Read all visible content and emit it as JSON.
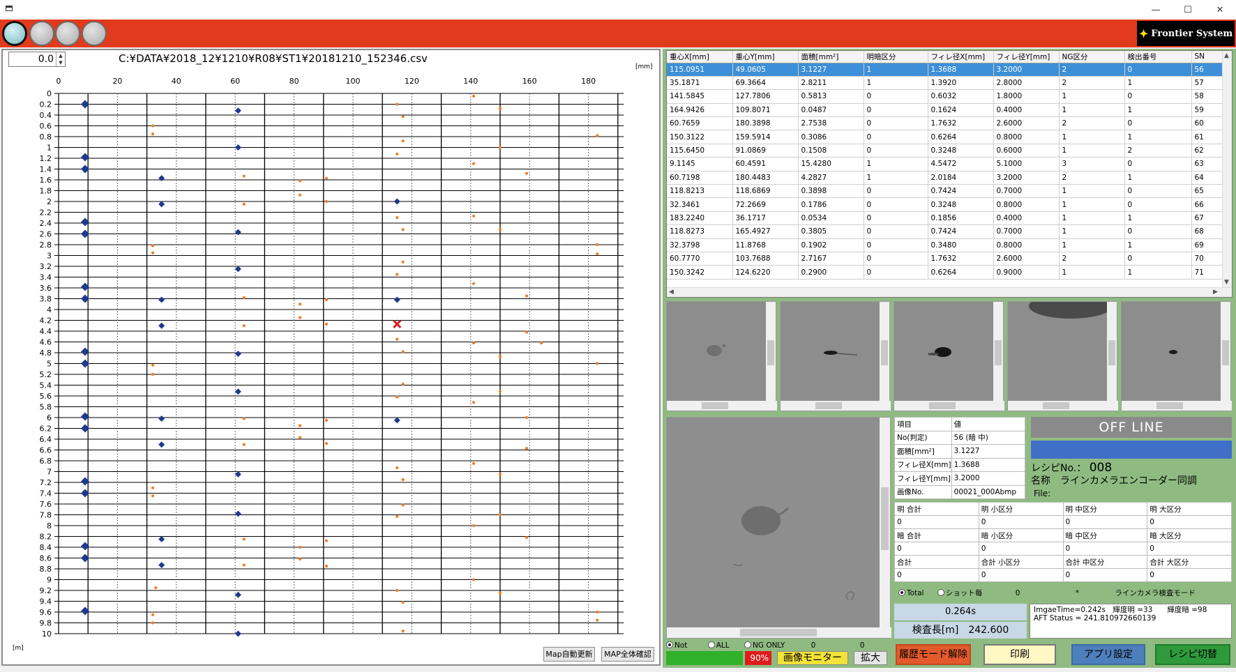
{
  "window": {
    "minimize": "—",
    "maximize": "☐",
    "close": "✕"
  },
  "logo": {
    "text": "Frontier System"
  },
  "map": {
    "spin_value": "0.0",
    "file_path": "C:¥DATA¥2018_12¥1210¥R08¥ST1¥20181210_152346.csv",
    "x_unit": "[mm]",
    "y_unit": "[m]",
    "x_ticks": [
      "0",
      "20",
      "40",
      "60",
      "80",
      "100",
      "120",
      "140",
      "160",
      "180"
    ],
    "y_ticks": [
      "0",
      "0.2",
      "0.4",
      "0.6",
      "0.8",
      "1",
      "1.2",
      "1.4",
      "1.6",
      "1.8",
      "2",
      "2.2",
      "2.4",
      "2.6",
      "2.8",
      "3",
      "3.2",
      "3.4",
      "3.6",
      "3.8",
      "4",
      "4.2",
      "4.4",
      "4.6",
      "4.8",
      "5",
      "5.2",
      "5.4",
      "5.6",
      "5.8",
      "6",
      "6.2",
      "6.4",
      "6.6",
      "6.8",
      "7",
      "7.2",
      "7.4",
      "7.6",
      "7.8",
      "8",
      "8.2",
      "8.4",
      "8.6",
      "8.8",
      "9",
      "9.2",
      "9.4",
      "9.6",
      "9.8",
      "10"
    ],
    "auto_update_btn": "Map自動更新",
    "full_view_btn": "MAP全体確認",
    "colors": {
      "large": "#1e3a8c",
      "small": "#f07d22",
      "selected": "#d62020"
    }
  },
  "grid": {
    "columns": [
      "重心X[mm]",
      "重心Y[mm]",
      "面積[mm²]",
      "明暗区分",
      "フィレ径X[mm]",
      "フィレ径Y[mm]",
      "NG区分",
      "検出番号",
      "SN"
    ],
    "rows": [
      [
        "115.0951",
        "49.0605",
        "3.1227",
        "1",
        "1.3688",
        "3.2000",
        "2",
        "0",
        "56"
      ],
      [
        "35.1871",
        "69.3664",
        "2.8211",
        "1",
        "1.3920",
        "2.8000",
        "2",
        "1",
        "57"
      ],
      [
        "141.5845",
        "127.7806",
        "0.5813",
        "0",
        "0.6032",
        "1.8000",
        "1",
        "0",
        "58"
      ],
      [
        "164.9426",
        "109.8071",
        "0.0487",
        "0",
        "0.1624",
        "0.4000",
        "1",
        "1",
        "59"
      ],
      [
        "60.7659",
        "180.3898",
        "2.7538",
        "0",
        "1.7632",
        "2.6000",
        "2",
        "0",
        "60"
      ],
      [
        "150.3122",
        "159.5914",
        "0.3086",
        "0",
        "0.6264",
        "0.8000",
        "1",
        "1",
        "61"
      ],
      [
        "115.6450",
        "91.0869",
        "0.1508",
        "0",
        "0.3248",
        "0.6000",
        "1",
        "2",
        "62"
      ],
      [
        "9.1145",
        "60.4591",
        "15.4280",
        "1",
        "4.5472",
        "5.1000",
        "3",
        "0",
        "63"
      ],
      [
        "60.7198",
        "180.4483",
        "4.2827",
        "1",
        "2.0184",
        "3.2000",
        "2",
        "1",
        "64"
      ],
      [
        "118.8213",
        "118.6869",
        "0.3898",
        "0",
        "0.7424",
        "0.7000",
        "1",
        "0",
        "65"
      ],
      [
        "32.3461",
        "72.2669",
        "0.1786",
        "0",
        "0.3248",
        "0.8000",
        "1",
        "0",
        "66"
      ],
      [
        "183.2240",
        "36.1717",
        "0.0534",
        "0",
        "0.1856",
        "0.4000",
        "1",
        "1",
        "67"
      ],
      [
        "118.8273",
        "165.4927",
        "0.3805",
        "0",
        "0.7424",
        "0.7000",
        "1",
        "0",
        "68"
      ],
      [
        "32.3798",
        "11.8768",
        "0.1902",
        "0",
        "0.3480",
        "0.8000",
        "1",
        "1",
        "69"
      ],
      [
        "60.7770",
        "103.7688",
        "2.7167",
        "0",
        "1.7632",
        "2.6000",
        "2",
        "0",
        "70"
      ],
      [
        "150.3242",
        "124.6220",
        "0.2900",
        "0",
        "0.6264",
        "0.9000",
        "1",
        "1",
        "71"
      ]
    ]
  },
  "info": {
    "header": [
      "項目",
      "値"
    ],
    "rows": [
      [
        "No(判定)",
        "56 (暗 中)"
      ],
      [
        "面積[mm²]",
        "3.1227"
      ],
      [
        "フィレ径X[mm]",
        "1.3688"
      ],
      [
        "フィレ径Y[mm]",
        "3.2000"
      ],
      [
        "画像No.",
        "00021_000Abmp"
      ]
    ]
  },
  "status": {
    "offline": "OFF LINE",
    "recipe_label": "レシピNo.：",
    "recipe_no": "008",
    "name_label": "名称",
    "name_value": "ラインカメラエンコーダー同調",
    "file_label": "File:"
  },
  "counts": {
    "rows": [
      [
        "明 合計",
        "明 小区分",
        "明 中区分",
        "明 大区分"
      ],
      [
        "0",
        "0",
        "0",
        "0"
      ],
      [
        "暗 合計",
        "暗 小区分",
        "暗 中区分",
        "暗 大区分"
      ],
      [
        "0",
        "0",
        "0",
        "0"
      ],
      [
        "合計",
        "合計 小区分",
        "合計 中区分",
        "合計 大区分"
      ],
      [
        "0",
        "0",
        "0",
        "0"
      ]
    ]
  },
  "mode": {
    "total": "Total",
    "shot": "ショット毎",
    "shot_count": "0",
    "star": "*",
    "mode_text": "ラインカメラ検査モード"
  },
  "timing": {
    "time": "0.264s",
    "length_label": "検査長[m]",
    "length_value": "242.600"
  },
  "status_text": "ImgaeTime=0.242s　輝度明 =33　　輝度暗 =98\nAFT Status = 241.810972660139",
  "filter": {
    "not": "Not",
    "all": "ALL",
    "ng_only": "NG ONLY",
    "count_a": "0",
    "count_b": "0"
  },
  "bottom": {
    "percent": "90%",
    "monitor": "画像モニター",
    "zoom": "拡大",
    "history": "履歴モード解除",
    "print": "印刷",
    "app_settings": "アプリ設定",
    "recipe_switch": "レシピ切替"
  }
}
